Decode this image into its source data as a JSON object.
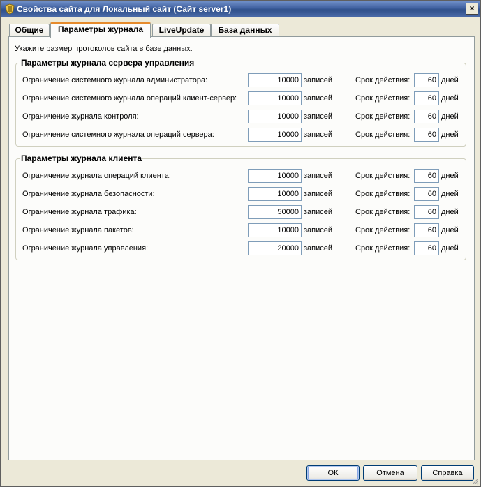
{
  "window": {
    "title": "Свойства сайта для Локальный сайт (Сайт server1)",
    "close_label": "×"
  },
  "tabs": [
    {
      "label": "Общие",
      "active": false
    },
    {
      "label": "Параметры журнала",
      "active": true
    },
    {
      "label": "LiveUpdate",
      "active": false
    },
    {
      "label": "База данных",
      "active": false
    }
  ],
  "panel": {
    "hint": "Укажите размер протоколов сайта в базе данных."
  },
  "labels": {
    "unit": "записей",
    "term": "Срок действия:",
    "days": "дней"
  },
  "server_group": {
    "title": "Параметры журнала сервера управления",
    "rows": [
      {
        "label": "Ограничение системного журнала администратора:",
        "count": "10000",
        "days": "60"
      },
      {
        "label": "Ограничение системного журнала операций клиент-сервер:",
        "count": "10000",
        "days": "60"
      },
      {
        "label": "Ограничение журнала контроля:",
        "count": "10000",
        "days": "60"
      },
      {
        "label": "Ограничение системного журнала операций сервера:",
        "count": "10000",
        "days": "60"
      }
    ]
  },
  "client_group": {
    "title": "Параметры журнала клиента",
    "rows": [
      {
        "label": "Ограничение журнала операций клиента:",
        "count": "10000",
        "days": "60"
      },
      {
        "label": "Ограничение журнала безопасности:",
        "count": "10000",
        "days": "60"
      },
      {
        "label": "Ограничение журнала трафика:",
        "count": "50000",
        "days": "60"
      },
      {
        "label": "Ограничение журнала пакетов:",
        "count": "10000",
        "days": "60"
      },
      {
        "label": "Ограничение журнала управления:",
        "count": "20000",
        "days": "60"
      }
    ]
  },
  "buttons": {
    "ok": "ОК",
    "cancel": "Отмена",
    "help": "Справка"
  },
  "colors": {
    "titlebar": "#3e5f9e",
    "active_tab_accent": "#e68b2c",
    "input_border": "#7f9db9"
  }
}
